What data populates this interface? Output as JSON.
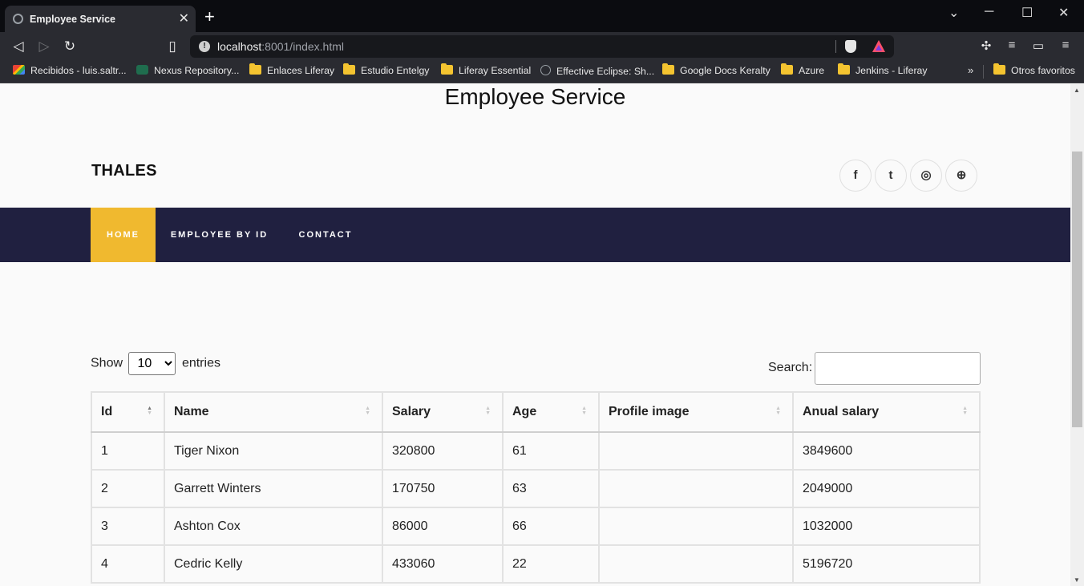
{
  "browser": {
    "tab_title": "Employee Service",
    "url_host": "localhost",
    "url_rest": ":8001/index.html",
    "bookmarks": [
      {
        "label": "Recibidos - luis.saltr...",
        "icon": "gmail-icon"
      },
      {
        "label": "Nexus Repository...",
        "icon": "nexus-icon"
      },
      {
        "label": "Enlaces Liferay",
        "icon": "folder-icon"
      },
      {
        "label": "Estudio Entelgy",
        "icon": "folder-icon"
      },
      {
        "label": "Liferay Essential",
        "icon": "folder-icon"
      },
      {
        "label": "Effective Eclipse: Sh...",
        "icon": "globe-icon"
      },
      {
        "label": "Google Docs Keralty",
        "icon": "folder-icon"
      },
      {
        "label": "Azure",
        "icon": "folder-icon"
      },
      {
        "label": "Jenkins - Liferay",
        "icon": "folder-icon"
      }
    ],
    "other_bookmarks": "Otros favoritos"
  },
  "page": {
    "title": "Employee Service",
    "brand": "THALES",
    "social": [
      {
        "icon": "facebook-icon",
        "glyph": "f"
      },
      {
        "icon": "twitter-icon",
        "glyph": "t"
      },
      {
        "icon": "instagram-icon",
        "glyph": "◎"
      },
      {
        "icon": "dribbble-icon",
        "glyph": "⊕"
      }
    ],
    "nav": [
      {
        "label": "HOME",
        "active": true
      },
      {
        "label": "EMPLOYEE BY ID",
        "active": false
      },
      {
        "label": "CONTACT",
        "active": false
      }
    ],
    "accent_color": "#f0b92f",
    "nav_color": "#202040"
  },
  "table_controls": {
    "show_label": "Show",
    "entries_label": "entries",
    "page_length": "10",
    "search_label": "Search:",
    "search_value": ""
  },
  "table": {
    "columns": [
      "Id",
      "Name",
      "Salary",
      "Age",
      "Profile image",
      "Anual salary"
    ],
    "rows": [
      [
        "1",
        "Tiger Nixon",
        "320800",
        "61",
        "",
        "3849600"
      ],
      [
        "2",
        "Garrett Winters",
        "170750",
        "63",
        "",
        "2049000"
      ],
      [
        "3",
        "Ashton Cox",
        "86000",
        "66",
        "",
        "1032000"
      ],
      [
        "4",
        "Cedric Kelly",
        "433060",
        "22",
        "",
        "5196720"
      ]
    ]
  }
}
